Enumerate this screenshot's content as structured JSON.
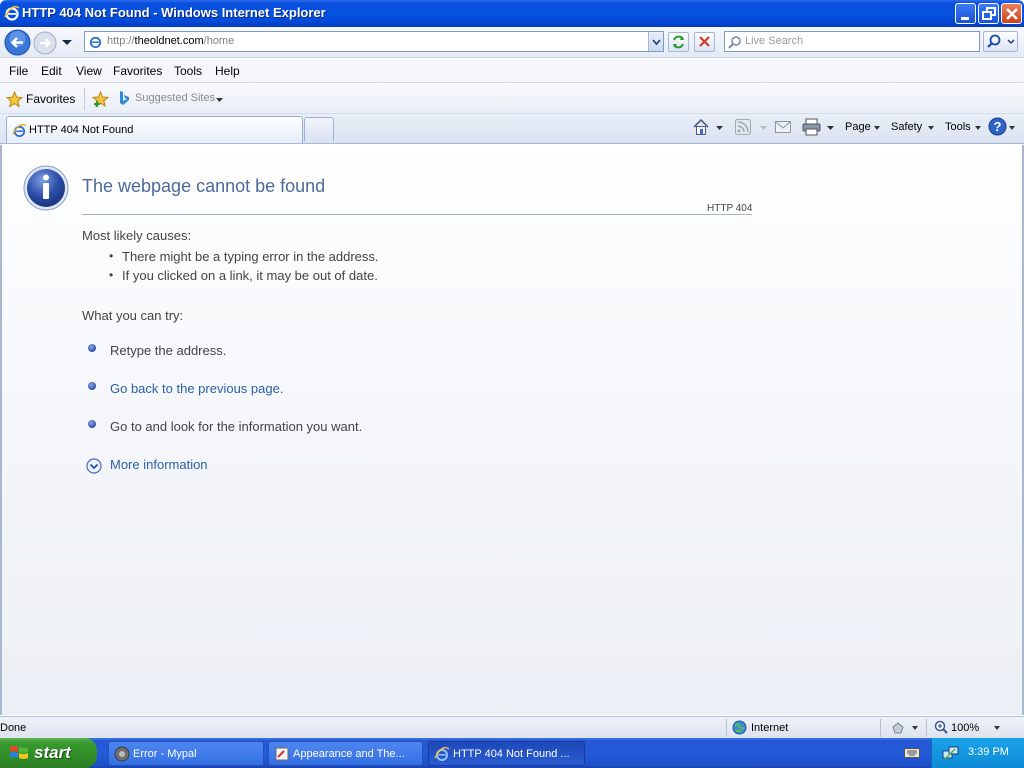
{
  "window": {
    "title": "HTTP 404 Not Found - Windows Internet Explorer"
  },
  "address": {
    "url_prefix": "http://",
    "url_host": "theoldnet.com",
    "url_path": "/home"
  },
  "search": {
    "placeholder": "Live Search"
  },
  "menu": [
    "File",
    "Edit",
    "View",
    "Favorites",
    "Tools",
    "Help"
  ],
  "favorites_bar": {
    "favorites_label": "Favorites",
    "suggested_label": "Suggested Sites"
  },
  "tab": {
    "title": "HTTP 404 Not Found"
  },
  "command_bar": {
    "page": "Page",
    "safety": "Safety",
    "tools": "Tools"
  },
  "error_page": {
    "heading": "The webpage cannot be found",
    "code": "HTTP 404",
    "causes_title": "Most likely causes:",
    "causes": [
      "There might be a typing error in the address.",
      "If you clicked on a link, it may be out of date."
    ],
    "try_title": "What you can try:",
    "try_retype": "Retype the address.",
    "try_back_link": "Go back to the previous page.",
    "try_goto": "Go to  and look for the information you want.",
    "more_info": "More information"
  },
  "status": {
    "text": "Done",
    "zone": "Internet",
    "zoom": "100%"
  },
  "taskbar": {
    "start": "start",
    "items": [
      "Error - Mypal",
      "Appearance and The...",
      "HTTP 404 Not Found ..."
    ],
    "clock": "3:39 PM"
  },
  "colors": {
    "titlebar": "#0552df",
    "heading": "#4e6a9a",
    "link": "#2b61a5",
    "taskbar": "#235bd8",
    "start": "#3a9a31"
  }
}
